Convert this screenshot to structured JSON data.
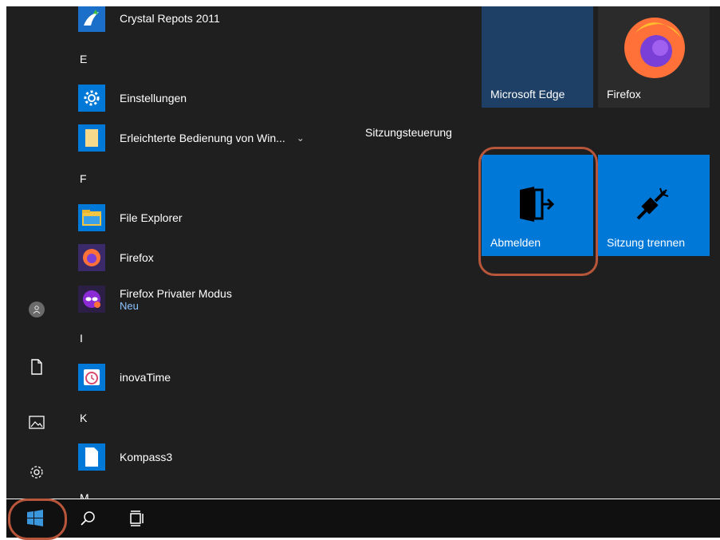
{
  "apps": {
    "crystal": {
      "label": "Crystal Repots 2011"
    },
    "letter_e": "E",
    "einstellungen": {
      "label": "Einstellungen"
    },
    "erleichterte": {
      "label": "Erleichterte Bedienung von Win...",
      "expand_icon": "chevron-down-icon"
    },
    "letter_f": "F",
    "file_explorer": {
      "label": "File Explorer"
    },
    "firefox": {
      "label": "Firefox"
    },
    "firefox_private": {
      "label": "Firefox Privater Modus",
      "badge": "Neu"
    },
    "letter_i": "I",
    "inovatime": {
      "label": "inovaTime"
    },
    "letter_k": "K",
    "kompass3": {
      "label": "Kompass3"
    },
    "letter_m": "M"
  },
  "tiles": {
    "group_title": "Sitzungsteuerung",
    "edge": {
      "label": "Microsoft Edge"
    },
    "firefox": {
      "label": "Firefox"
    },
    "abmelden": {
      "label": "Abmelden"
    },
    "sitzung_trennen": {
      "label": "Sitzung trennen"
    }
  },
  "left_rail": [
    "user-avatar",
    "documents-icon",
    "pictures-icon",
    "settings-gear-icon"
  ],
  "taskbar": [
    "windows-start-icon",
    "search-icon",
    "task-view-icon"
  ],
  "colors": {
    "accent": "#0078d7",
    "highlight_ring": "#b7563b",
    "menu_bg": "#1f1f1f",
    "taskbar_bg": "#101010",
    "tile_dark": "#2b2b2b",
    "edge_tile": "#1e3f66",
    "link": "#8dc4ff"
  }
}
